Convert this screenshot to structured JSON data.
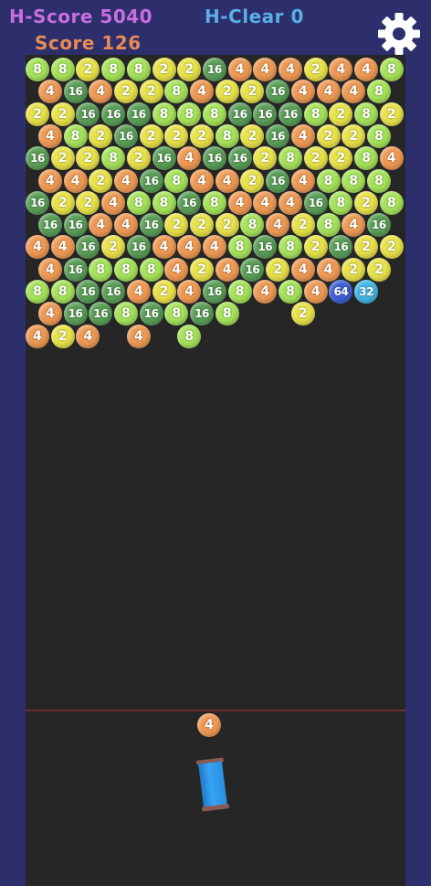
{
  "hud": {
    "high_score": "H-Score 5040",
    "high_clear": "H-Clear 0",
    "score": "Score 126"
  },
  "settings_icon": "gear-icon",
  "colors": {
    "2": "#e8e24a",
    "4": "#ee9a55",
    "8": "#a6e35a",
    "16": "#5a9e58",
    "32": "#44b8e6",
    "64": "#3c62d8"
  },
  "grid_rows": [
    [
      "8",
      "8",
      "2",
      "8",
      "8",
      "2",
      "2",
      "16",
      "4",
      "4",
      "4",
      "2",
      "4",
      "4",
      "8"
    ],
    [
      "4",
      "16",
      "4",
      "2",
      "2",
      "8",
      "4",
      "2",
      "2",
      "16",
      "4",
      "4",
      "4",
      "8"
    ],
    [
      "2",
      "2",
      "16",
      "16",
      "16",
      "8",
      "8",
      "8",
      "16",
      "16",
      "16",
      "8",
      "2",
      "8",
      "2"
    ],
    [
      "4",
      "8",
      "2",
      "16",
      "2",
      "2",
      "2",
      "8",
      "2",
      "16",
      "4",
      "2",
      "2",
      "8"
    ],
    [
      "16",
      "2",
      "2",
      "8",
      "2",
      "16",
      "4",
      "16",
      "16",
      "2",
      "8",
      "2",
      "2",
      "8",
      "4"
    ],
    [
      "4",
      "4",
      "2",
      "4",
      "16",
      "8",
      "4",
      "4",
      "2",
      "16",
      "4",
      "8",
      "8",
      "8"
    ],
    [
      "16",
      "2",
      "2",
      "4",
      "8",
      "8",
      "16",
      "8",
      "4",
      "4",
      "4",
      "16",
      "8",
      "2",
      "8"
    ],
    [
      "16",
      "16",
      "4",
      "4",
      "16",
      "2",
      "2",
      "2",
      "8",
      "4",
      "2",
      "8",
      "4",
      "16"
    ],
    [
      "4",
      "4",
      "16",
      "2",
      "16",
      "4",
      "4",
      "4",
      "8",
      "16",
      "8",
      "2",
      "16",
      "2",
      "2"
    ],
    [
      "4",
      "16",
      "8",
      "8",
      "8",
      "4",
      "2",
      "4",
      "16",
      "2",
      "4",
      "4",
      "2",
      "2"
    ],
    [
      "8",
      "8",
      "16",
      "16",
      "4",
      "2",
      "4",
      "16",
      "8",
      "4",
      "8",
      "4",
      "64",
      "32"
    ],
    [
      "4",
      "16",
      "16",
      "8",
      "16",
      "8",
      "16",
      "8",
      "",
      "",
      "2"
    ],
    [
      "4",
      "2",
      "4",
      "",
      "4",
      "",
      "8"
    ]
  ],
  "launcher": {
    "next_bubble": "4"
  }
}
